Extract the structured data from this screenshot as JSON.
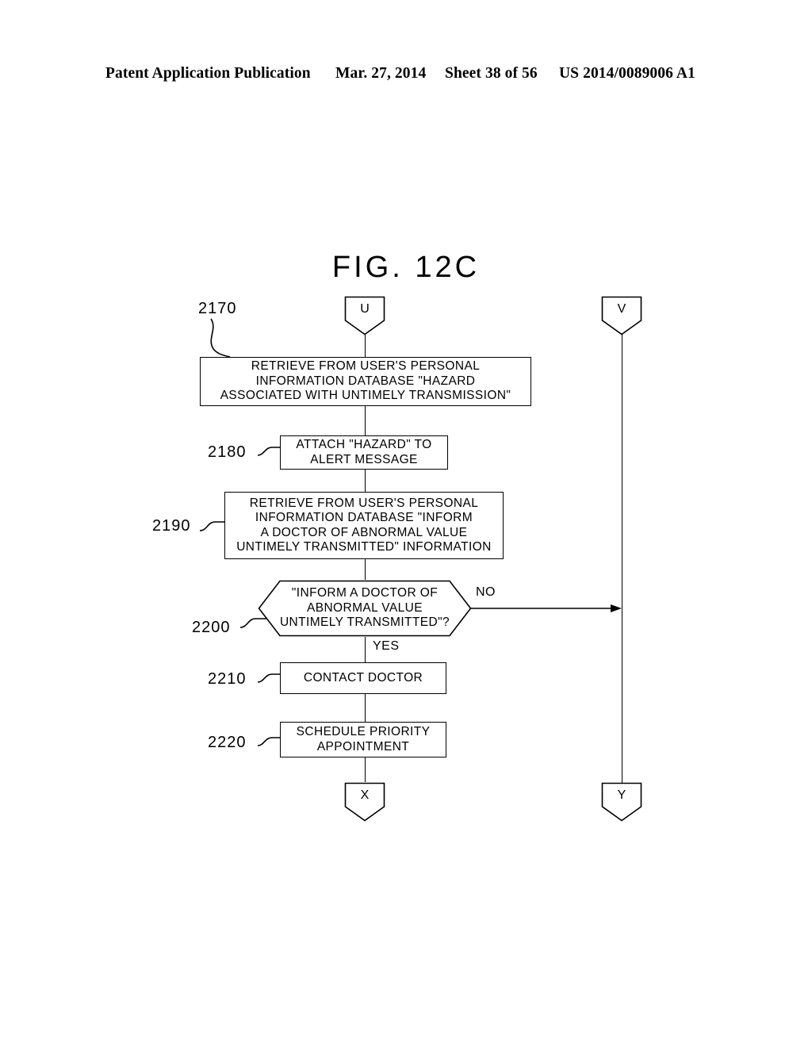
{
  "header": {
    "publication": "Patent Application Publication",
    "date": "Mar. 27, 2014",
    "sheet": "Sheet 38 of 56",
    "patent_number": "US 2014/0089006 A1"
  },
  "figure": {
    "title": "FIG.  12C",
    "connectors": {
      "top_center": "U",
      "top_right": "V",
      "bottom_center": "X",
      "bottom_right": "Y"
    },
    "branch_labels": {
      "no": "NO",
      "yes": "YES"
    },
    "nodes": [
      {
        "ref": "2170",
        "type": "process",
        "text": "RETRIEVE FROM USER'S PERSONAL\nINFORMATION DATABASE \"HAZARD\nASSOCIATED WITH UNTIMELY TRANSMISSION\""
      },
      {
        "ref": "2180",
        "type": "process",
        "text": "ATTACH \"HAZARD\" TO\nALERT MESSAGE"
      },
      {
        "ref": "2190",
        "type": "process",
        "text": "RETRIEVE FROM USER'S PERSONAL\nINFORMATION DATABASE \"INFORM\nA DOCTOR OF ABNORMAL VALUE\nUNTIMELY TRANSMITTED\" INFORMATION"
      },
      {
        "ref": "2200",
        "type": "decision",
        "text": "\"INFORM A DOCTOR OF\nABNORMAL VALUE\nUNTIMELY TRANSMITTED\"?"
      },
      {
        "ref": "2210",
        "type": "process",
        "text": "CONTACT DOCTOR"
      },
      {
        "ref": "2220",
        "type": "process",
        "text": "SCHEDULE PRIORITY\nAPPOINTMENT"
      }
    ]
  },
  "colors": {
    "ink": "#000000",
    "paper": "#ffffff"
  }
}
